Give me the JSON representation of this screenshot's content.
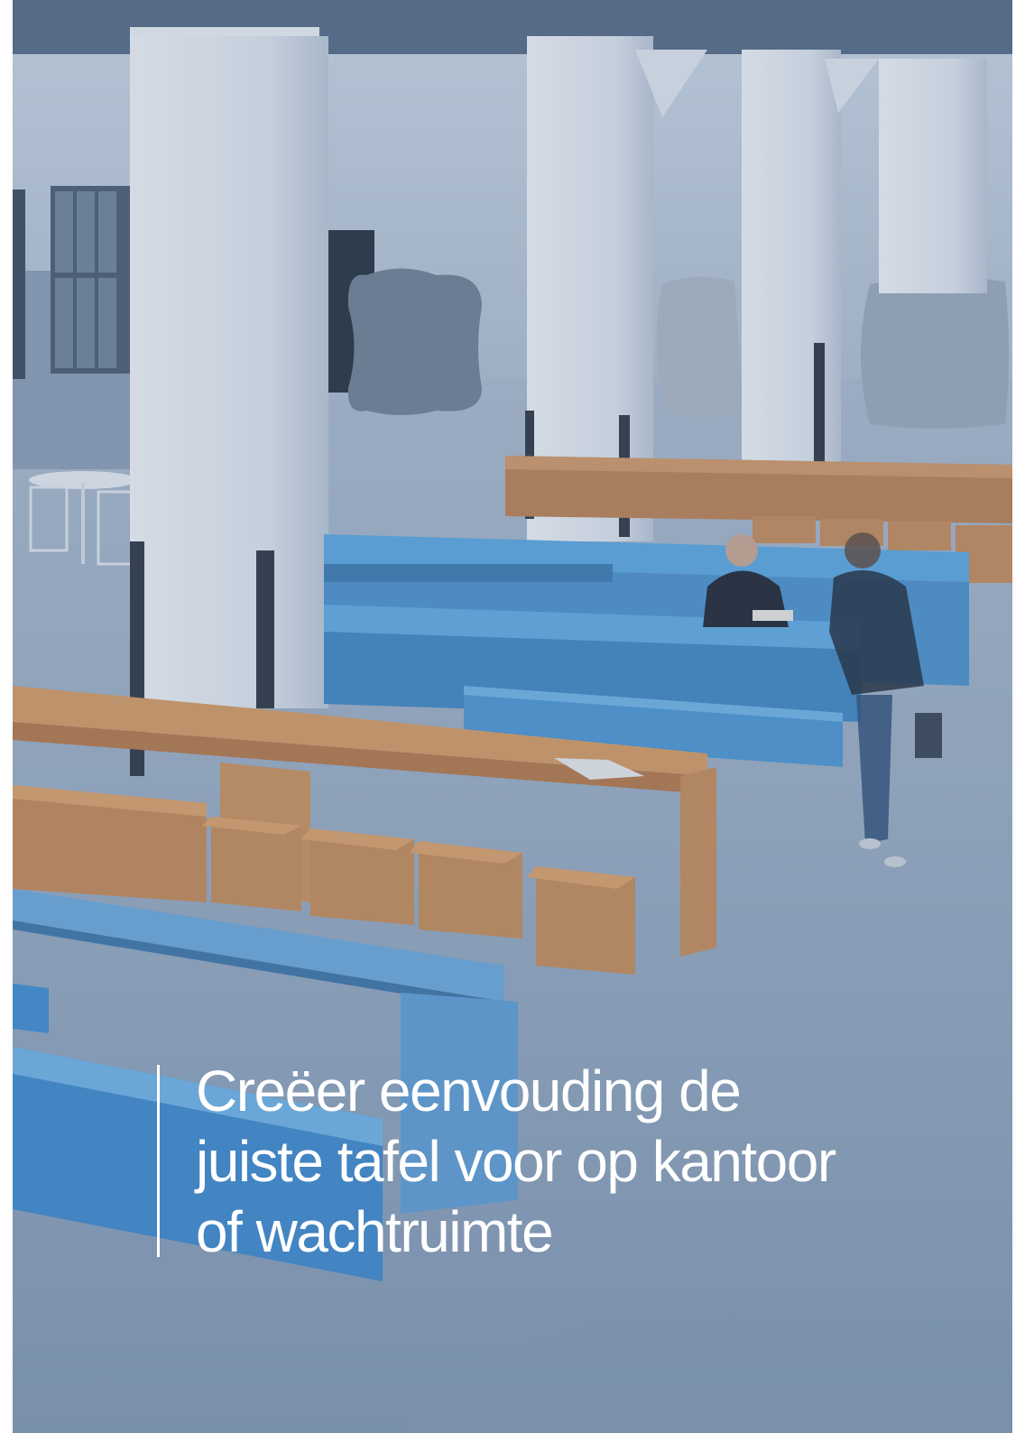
{
  "background_photo": {
    "subject": "open office hall with white pillars, blue and orange tables with benches and stools, people walking",
    "colors": {
      "tint": "#5c7696",
      "floor": "#8ea4be",
      "pillar": "#dfe6ee",
      "table_blue": "#4f9ad6",
      "table_orange": "#c88d55",
      "wall": "#b9c8d8"
    }
  },
  "headline": {
    "line1": "Creëer eenvouding de",
    "line2": "juiste tafel voor op kantoor",
    "line3": "of wachtruimte"
  },
  "quote_bar_color": "#ffffff"
}
